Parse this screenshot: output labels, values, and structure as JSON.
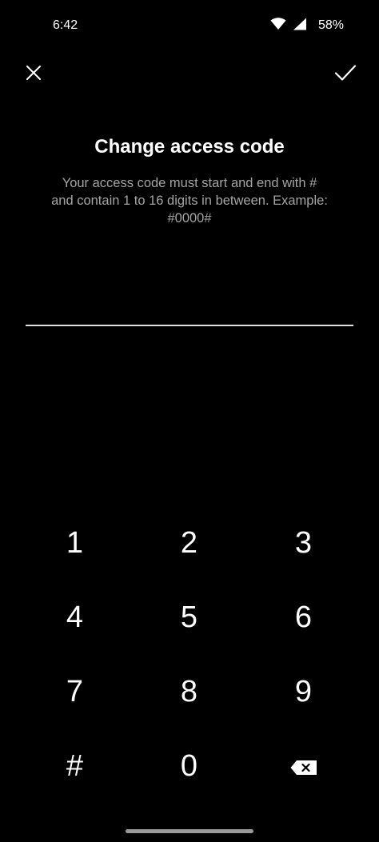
{
  "status_bar": {
    "time": "6:42",
    "battery": "58%",
    "icons": [
      "wifi-icon",
      "cellular-signal-icon"
    ]
  },
  "toolbar": {
    "close_icon": "close-icon",
    "confirm_icon": "check-icon"
  },
  "dialog": {
    "title": "Change access code",
    "description": "Your access code must start and end with #\nand contain 1 to 16 digits in between. Example:\n#0000#",
    "code_value": "",
    "code_placeholder": ""
  },
  "keypad": {
    "keys": [
      "1",
      "2",
      "3",
      "4",
      "5",
      "6",
      "7",
      "8",
      "9",
      "#",
      "0"
    ],
    "backspace_icon": "backspace-icon"
  },
  "colors": {
    "background": "#000000",
    "text_primary": "#ffffff",
    "text_secondary": "#a4a4a4",
    "input_underline": "#e0e0e0"
  }
}
